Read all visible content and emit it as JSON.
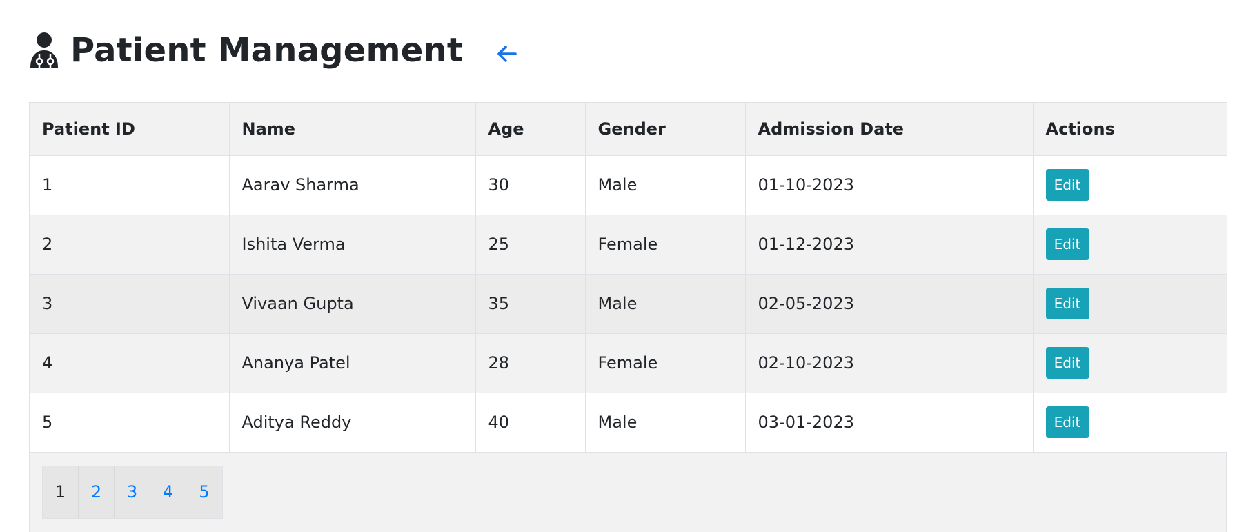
{
  "header": {
    "title": "Patient Management",
    "title_icon": "doctor-icon",
    "back_icon": "arrow-left-icon"
  },
  "colors": {
    "edit_button": "#17a2b8",
    "link": "#007bff",
    "text": "#212529"
  },
  "table": {
    "columns": [
      "Patient ID",
      "Name",
      "Age",
      "Gender",
      "Admission Date",
      "Actions"
    ],
    "rows": [
      {
        "id": "1",
        "name": "Aarav Sharma",
        "age": "30",
        "gender": "Male",
        "admission_date": "01-10-2023",
        "action": "Edit"
      },
      {
        "id": "2",
        "name": "Ishita Verma",
        "age": "25",
        "gender": "Female",
        "admission_date": "01-12-2023",
        "action": "Edit"
      },
      {
        "id": "3",
        "name": "Vivaan Gupta",
        "age": "35",
        "gender": "Male",
        "admission_date": "02-05-2023",
        "action": "Edit"
      },
      {
        "id": "4",
        "name": "Ananya Patel",
        "age": "28",
        "gender": "Female",
        "admission_date": "02-10-2023",
        "action": "Edit"
      },
      {
        "id": "5",
        "name": "Aditya Reddy",
        "age": "40",
        "gender": "Male",
        "admission_date": "03-01-2023",
        "action": "Edit"
      }
    ]
  },
  "pagination": {
    "pages": [
      "1",
      "2",
      "3",
      "4",
      "5"
    ],
    "current": "1"
  }
}
